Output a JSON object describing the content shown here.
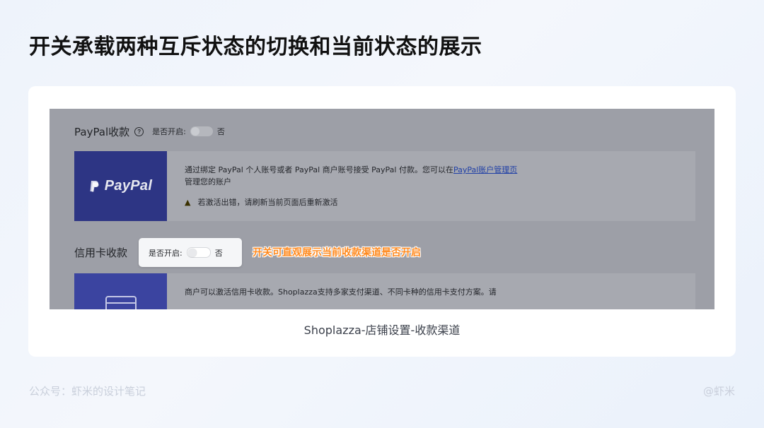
{
  "slide": {
    "title": "开关承载两种互斥状态的切换和当前状态的展示",
    "caption": "Shoplazza-店铺设置-收款渠道",
    "footer_left": "公众号：虾米的设计笔记",
    "footer_right": "@虾米"
  },
  "screenshot": {
    "paypal_section": {
      "title": "PayPal收款",
      "help_icon": "question-circle-icon",
      "enable_label": "是否开启:",
      "toggle_state": "off",
      "toggle_value_text": "否",
      "logo_text": "PayPal",
      "description_prefix": "通过绑定 PayPal 个人账号或者 PayPal 商户账号接受 PayPal 付款。您可以在",
      "description_link": "PayPal账户管理页",
      "description_suffix": "管理您的账户",
      "warning_icon": "warning-triangle-icon",
      "warning_text": "若激活出错，请刷新当前页面后重新激活"
    },
    "credit_section": {
      "title": "信用卡收款",
      "enable_label": "是否开启:",
      "toggle_state": "off",
      "toggle_value_text": "否",
      "card_icon": "credit-card-icon",
      "description": "商户可以激活信用卡收款。Shoplazza支持多家支付渠道、不同卡种的信用卡支付方案。请"
    },
    "callout_text": "开关可直观展示当前收款渠道是否开启"
  },
  "colors": {
    "overlay_gray": "#9d9fa7",
    "paypal_blue": "#2d3584",
    "callout_orange": "#ff8a1f",
    "link_blue": "#1f3fa6"
  }
}
